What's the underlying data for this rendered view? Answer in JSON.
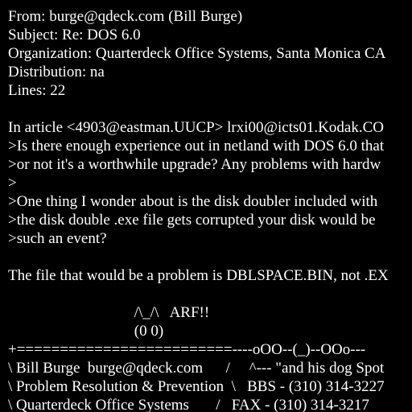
{
  "message": {
    "lines": [
      "From: burge@qdeck.com (Bill Burge)",
      "Subject: Re: DOS 6.0",
      "Organization: Quarterdeck Office Systems, Santa Monica CA",
      "Distribution: na",
      "Lines: 22",
      "",
      "In article <4903@eastman.UUCP> lrxi00@icts01.Kodak.CO",
      ">Is there enough experience out in netland with DOS 6.0 that",
      ">or not it's a worthwhile upgrade? Any problems with hardw",
      ">",
      ">One thing I wonder about is the disk doubler included with",
      ">the disk double .exe file gets corrupted your disk would be",
      ">such an event?",
      "",
      "The file that would be a problem is DBLSPACE.BIN, not .EX",
      "",
      "                                 /\\_/\\   ARF!!",
      "                                 (0 0)",
      "+=========================----oOO--(_)--OOo---",
      "\\ Bill Burge  burge@qdeck.com      /     ^--- \"and his dog Spot",
      "\\ Problem Resolution & Prevention  \\   BBS - (310) 314-3227",
      "\\ Quarterdeck Office Systems       /   FAX - (310) 314-3217"
    ]
  }
}
